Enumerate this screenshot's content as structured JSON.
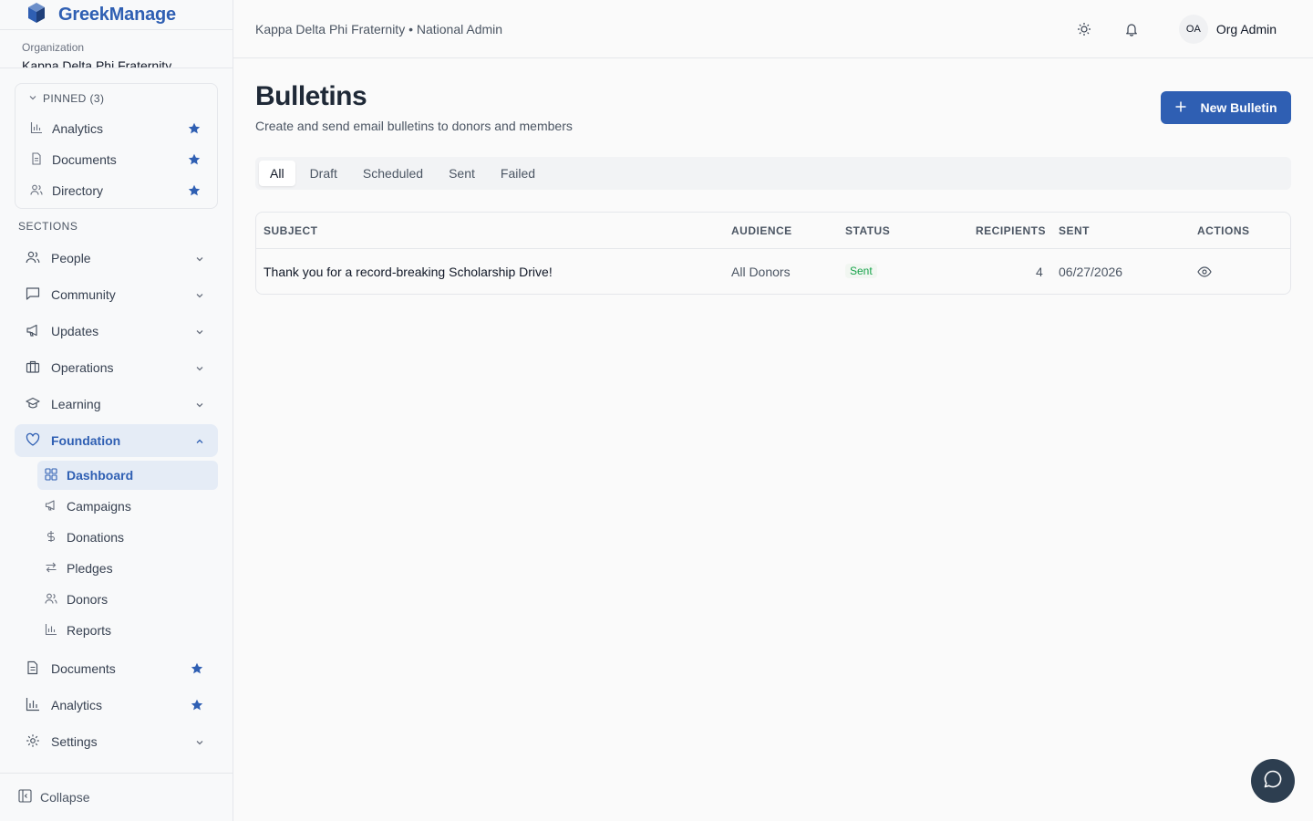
{
  "brand": {
    "name": "GreekManage"
  },
  "org": {
    "label": "Organization",
    "name": "Kappa Delta Phi Fraternity"
  },
  "pinned": {
    "title": "PINNED (3)",
    "items": [
      {
        "label": "Analytics"
      },
      {
        "label": "Documents"
      },
      {
        "label": "Directory"
      }
    ]
  },
  "sections_label": "SECTIONS",
  "nav": {
    "people": "People",
    "community": "Community",
    "updates": "Updates",
    "operations": "Operations",
    "learning": "Learning",
    "foundation": "Foundation",
    "documents": "Documents",
    "analytics": "Analytics",
    "settings": "Settings"
  },
  "foundation_sub": {
    "dashboard": "Dashboard",
    "campaigns": "Campaigns",
    "donations": "Donations",
    "pledges": "Pledges",
    "donors": "Donors",
    "reports": "Reports"
  },
  "collapse_label": "Collapse",
  "header": {
    "breadcrumb": "Kappa Delta Phi Fraternity • National Admin",
    "avatar_initials": "OA",
    "user_name": "Org Admin"
  },
  "page": {
    "title": "Bulletins",
    "subtitle": "Create and send email bulletins to donors and members",
    "new_button": "New Bulletin"
  },
  "tabs": [
    "All",
    "Draft",
    "Scheduled",
    "Sent",
    "Failed"
  ],
  "table": {
    "headers": {
      "subject": "SUBJECT",
      "audience": "AUDIENCE",
      "status": "STATUS",
      "recipients": "RECIPIENTS",
      "sent": "SENT",
      "actions": "ACTIONS"
    },
    "rows": [
      {
        "subject": "Thank you for a record-breaking Scholarship Drive!",
        "audience": "All Donors",
        "status": "Sent",
        "recipients": "4",
        "sent": "06/27/2026"
      }
    ]
  },
  "colors": {
    "accent": "#2f5fb3",
    "success": "#16a34a",
    "chat": "#2d3e50"
  }
}
